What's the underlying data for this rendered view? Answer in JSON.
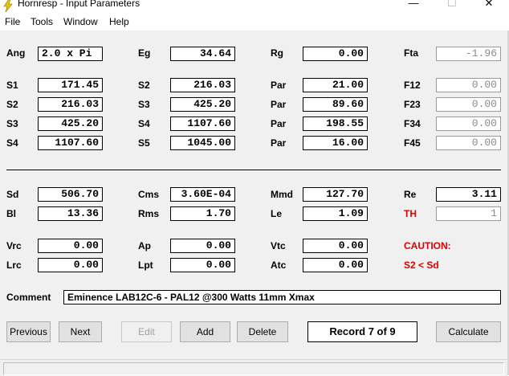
{
  "window": {
    "title": "Hornresp - Input Parameters",
    "minimize": "—",
    "maximize": "☐",
    "close": "✕"
  },
  "menu": [
    "File",
    "Tools",
    "Window",
    "Help"
  ],
  "fields": {
    "ang": {
      "label": "Ang",
      "value": "2.0 x Pi"
    },
    "eg": {
      "label": "Eg",
      "value": "34.64"
    },
    "rg": {
      "label": "Rg",
      "value": "0.00"
    },
    "fta": {
      "label": "Fta",
      "value": "-1.96"
    },
    "s1": {
      "label": "S1",
      "value": "171.45"
    },
    "s2_r2": {
      "label": "S2",
      "value": "216.03"
    },
    "par1": {
      "label": "Par",
      "value": "21.00"
    },
    "f12": {
      "label": "F12",
      "value": "0.00"
    },
    "s2": {
      "label": "S2",
      "value": "216.03"
    },
    "s3_r3": {
      "label": "S3",
      "value": "425.20"
    },
    "par2": {
      "label": "Par",
      "value": "89.60"
    },
    "f23": {
      "label": "F23",
      "value": "0.00"
    },
    "s3": {
      "label": "S3",
      "value": "425.20"
    },
    "s4_r4": {
      "label": "S4",
      "value": "1107.60"
    },
    "par3": {
      "label": "Par",
      "value": "198.55"
    },
    "f34": {
      "label": "F34",
      "value": "0.00"
    },
    "s4": {
      "label": "S4",
      "value": "1107.60"
    },
    "s5": {
      "label": "S5",
      "value": "1045.00"
    },
    "par4": {
      "label": "Par",
      "value": "16.00"
    },
    "f45": {
      "label": "F45",
      "value": "0.00"
    },
    "sd": {
      "label": "Sd",
      "value": "506.70"
    },
    "cms": {
      "label": "Cms",
      "value": "3.60E-04"
    },
    "mmd": {
      "label": "Mmd",
      "value": "127.70"
    },
    "re": {
      "label": "Re",
      "value": "3.11"
    },
    "bl": {
      "label": "Bl",
      "value": "13.36"
    },
    "rms": {
      "label": "Rms",
      "value": "1.70"
    },
    "le": {
      "label": "Le",
      "value": "1.09"
    },
    "th": {
      "label": "TH",
      "value": "1"
    },
    "vrc": {
      "label": "Vrc",
      "value": "0.00"
    },
    "ap": {
      "label": "Ap",
      "value": "0.00"
    },
    "vtc": {
      "label": "Vtc",
      "value": "0.00"
    },
    "lrc": {
      "label": "Lrc",
      "value": "0.00"
    },
    "lpt": {
      "label": "Lpt",
      "value": "0.00"
    },
    "atc": {
      "label": "Atc",
      "value": "0.00"
    }
  },
  "caution": {
    "title": "CAUTION:",
    "message": "S2 < Sd"
  },
  "comment": {
    "label": "Comment",
    "value": "Eminence LAB12C-6 - PAL12  @300 Watts 11mm Xmax"
  },
  "buttons": {
    "previous": "Previous",
    "next": "Next",
    "edit": "Edit",
    "add": "Add",
    "delete": "Delete",
    "calculate": "Calculate"
  },
  "record": "Record 7 of 9",
  "colors": {
    "caution": "#e00000",
    "client_bg": "#f0f0f0",
    "disabled_text": "#8a8a8a"
  }
}
